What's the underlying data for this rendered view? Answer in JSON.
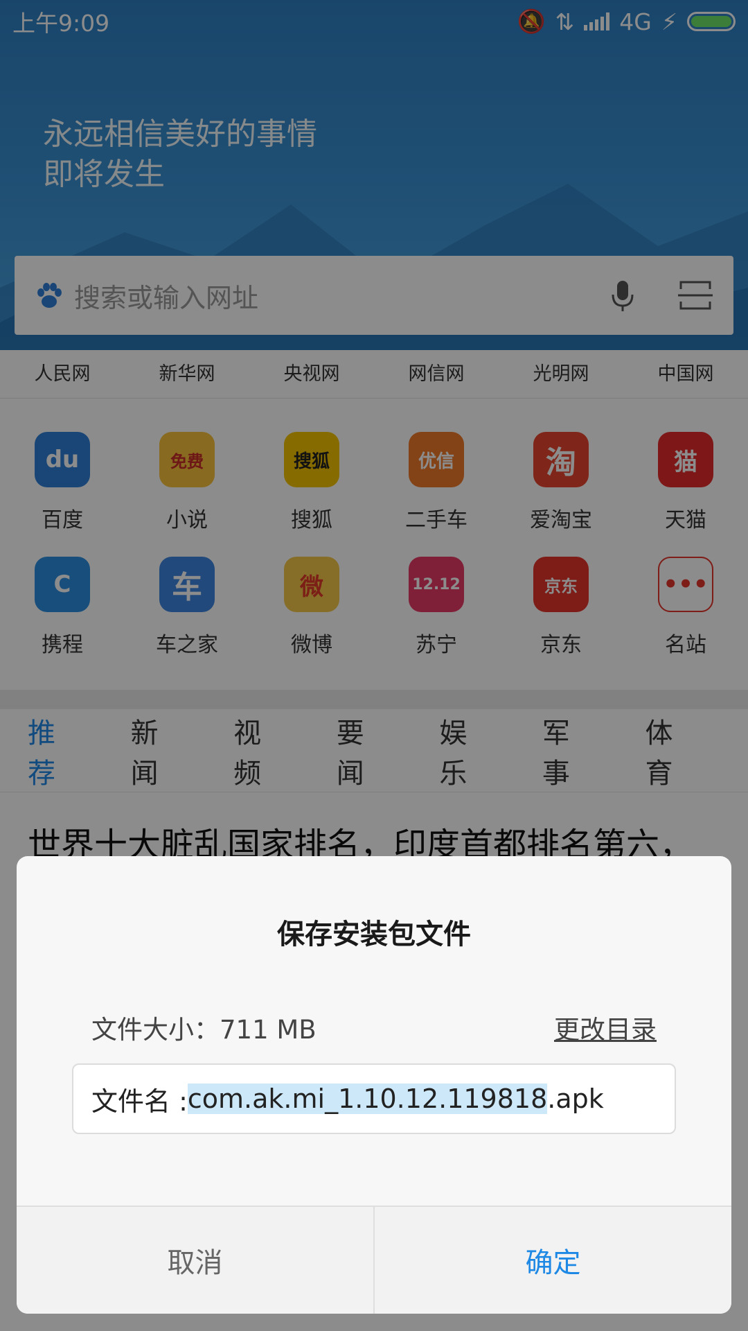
{
  "status_bar": {
    "time": "上午9:09",
    "network": "4G"
  },
  "hero": {
    "slogan_line1": "永远相信美好的事情",
    "slogan_line2": "即将发生"
  },
  "search": {
    "placeholder": "搜索或输入网址"
  },
  "quick_links": [
    "人民网",
    "新华网",
    "央视网",
    "网信网",
    "光明网",
    "中国网"
  ],
  "apps": [
    {
      "label": "百度",
      "color": "#2f80d8",
      "glyph": "du"
    },
    {
      "label": "小说",
      "color": "#f7c23c",
      "glyph": "免费"
    },
    {
      "label": "搜狐",
      "color": "#f5c400",
      "glyph": "搜狐"
    },
    {
      "label": "二手车",
      "color": "#f07a2a",
      "glyph": "优信"
    },
    {
      "label": "爱淘宝",
      "color": "#e8442e",
      "glyph": "淘"
    },
    {
      "label": "天猫",
      "color": "#e52d2d",
      "glyph": "猫"
    },
    {
      "label": "携程",
      "color": "#2d8fe0",
      "glyph": "C"
    },
    {
      "label": "车之家",
      "color": "#3c86e0",
      "glyph": "车"
    },
    {
      "label": "微博",
      "color": "#f6c94a",
      "glyph": "微"
    },
    {
      "label": "苏宁",
      "color": "#e93a66",
      "glyph": "12.12"
    },
    {
      "label": "京东",
      "color": "#e5332a",
      "glyph": "京东"
    },
    {
      "label": "名站",
      "color": "#ffffff",
      "glyph": "•••"
    }
  ],
  "tabs": [
    "推荐",
    "新闻",
    "视频",
    "要闻",
    "娱乐",
    "军事",
    "体育"
  ],
  "news": {
    "headline": "世界十大脏乱国家排名，印度首都排名第六，"
  },
  "dialog": {
    "title": "保存安装包文件",
    "size_label": "文件大小：711 MB",
    "change_dir": "更改目录",
    "filename_prefix": "文件名 : ",
    "filename_selected": "com.ak.mi_1.10.12.119818",
    "filename_ext": ".apk",
    "cancel": "取消",
    "confirm": "确定"
  },
  "colors": {
    "accent": "#1e88e5",
    "hero_top": "#2f7fc3"
  }
}
